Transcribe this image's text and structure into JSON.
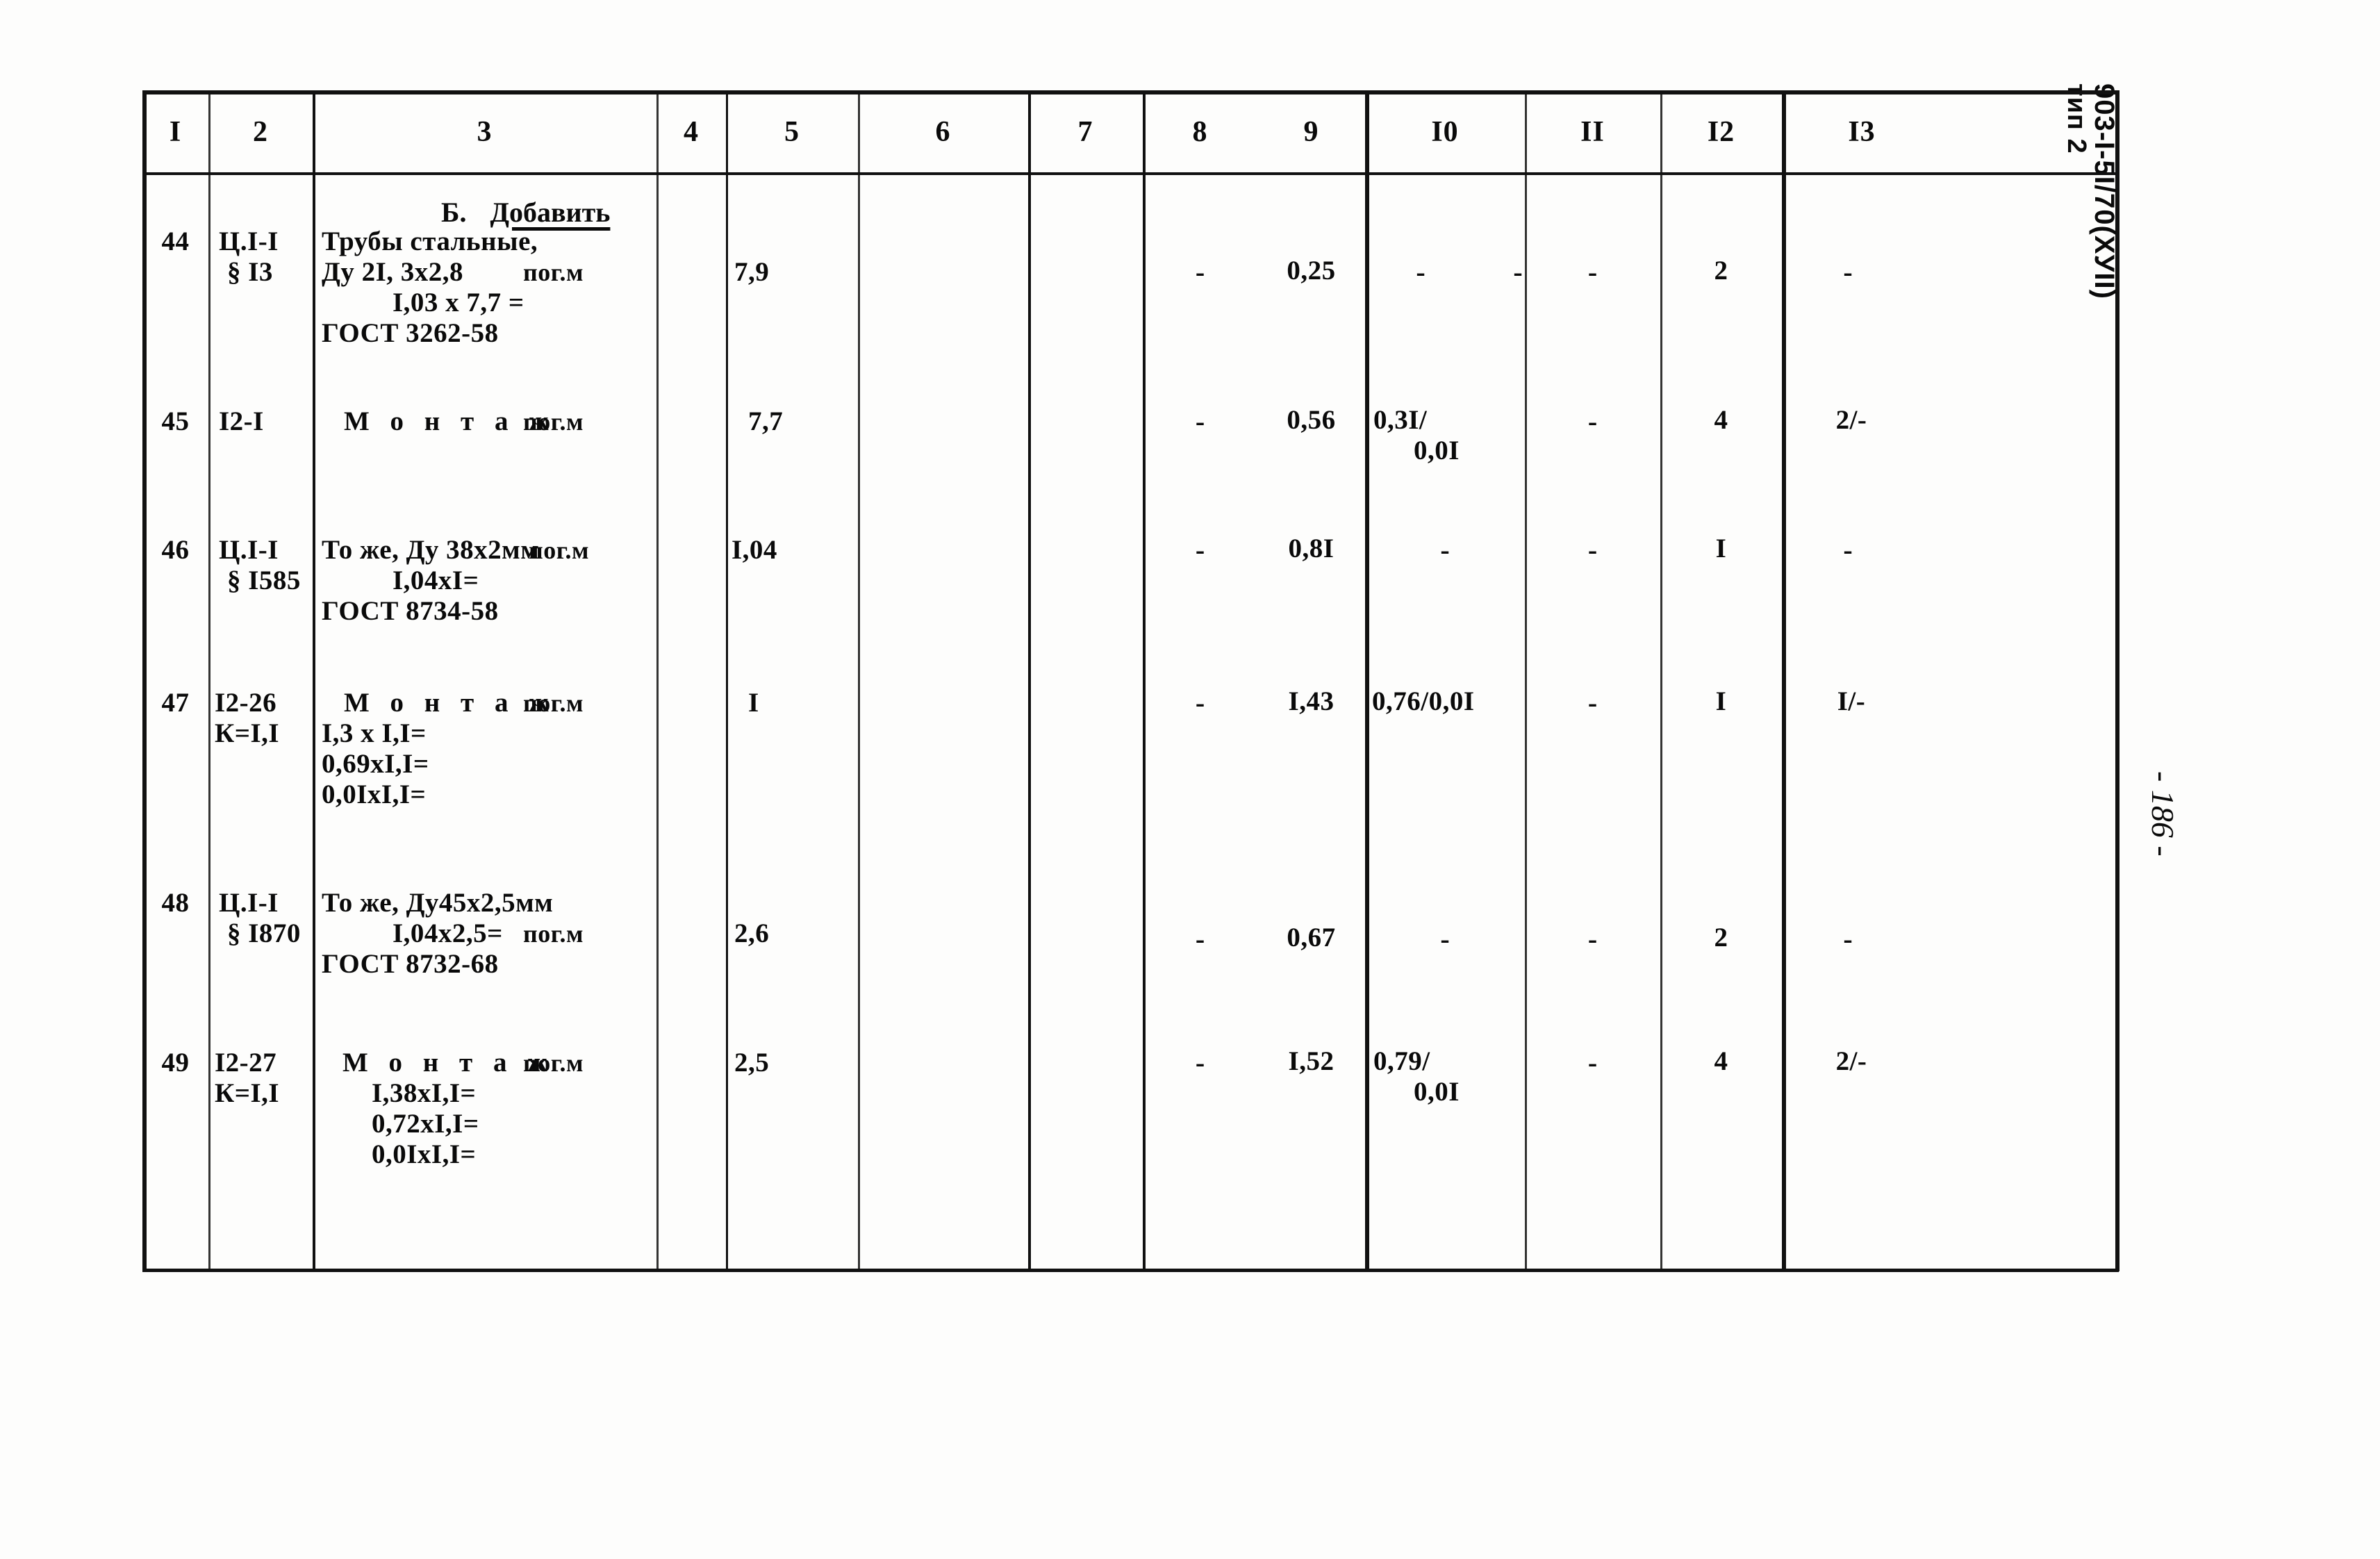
{
  "document": {
    "side_stamp_code": "903-I-5I/70(ХУII)",
    "side_stamp_sub": "тип 2",
    "page_number": "- 186 -"
  },
  "table": {
    "column_headers": [
      "I",
      "2",
      "3",
      "4",
      "5",
      "6",
      "7",
      "8",
      "9",
      "I0",
      "II",
      "I2",
      "I3"
    ],
    "section_caption": {
      "marker": "Б.",
      "text": "Добавить"
    },
    "rows": [
      {
        "num": "44",
        "code_line1": "Ц.I-I",
        "code_line2": "§ I3",
        "desc_line1": "Трубы стальные,",
        "desc_line2": "Ду 2I, 3х2,8",
        "desc_line3": "I,03 х 7,7 =",
        "desc_line4": "ГОСТ 3262-58",
        "unit": "пог.м",
        "qty": "7,9",
        "col6": "",
        "col7": "",
        "col8": "-",
        "col9": "0,25",
        "col10": "-",
        "col10b": "-",
        "col11": "-",
        "col12": "2",
        "col13": "-"
      },
      {
        "num": "45",
        "code_line1": "I2-I",
        "code_line2": "",
        "desc_line1": "М о н т а ж",
        "desc_line2": "",
        "desc_line3": "",
        "desc_line4": "",
        "unit": "пог.м",
        "qty": "7,7",
        "col6": "",
        "col7": "",
        "col8": "-",
        "col9": "0,56",
        "col10": "0,3I/",
        "col10b": "0,0I",
        "col11": "-",
        "col12": "4",
        "col13": "2/-"
      },
      {
        "num": "46",
        "code_line1": "Ц.I-I",
        "code_line2": "§ I585",
        "desc_line1": "То же, Ду 38х2мм",
        "desc_line2": "I,04хI=",
        "desc_line3": "ГОСТ 8734-58",
        "desc_line4": "",
        "unit": "пог.м",
        "qty": "I,04",
        "col6": "",
        "col7": "",
        "col8": "-",
        "col9": "0,8I",
        "col10": "-",
        "col10b": "",
        "col11": "-",
        "col12": "I",
        "col13": "-"
      },
      {
        "num": "47",
        "code_line1": "I2-26",
        "code_line2": "К=I,I",
        "desc_line1": "М о н т а ж",
        "desc_line2": "I,3 х I,I=",
        "desc_line3": "0,69хI,I=",
        "desc_line4": "0,0IхI,I=",
        "unit": "пог.м",
        "qty": "I",
        "col6": "",
        "col7": "",
        "col8": "-",
        "col9": "I,43",
        "col10": "0,76/0,0I",
        "col10b": "",
        "col11": "-",
        "col12": "I",
        "col13": "I/-"
      },
      {
        "num": "48",
        "code_line1": "Ц.I-I",
        "code_line2": "§ I870",
        "desc_line1": "То же, Ду45х2,5мм",
        "desc_line2": "I,04х2,5=",
        "desc_line3": "ГОСТ 8732-68",
        "desc_line4": "",
        "unit": "пог.м",
        "qty": "2,6",
        "col6": "",
        "col7": "",
        "col8": "-",
        "col9": "0,67",
        "col10": "-",
        "col10b": "",
        "col11": "-",
        "col12": "2",
        "col13": "-"
      },
      {
        "num": "49",
        "code_line1": "I2-27",
        "code_line2": "К=I,I",
        "desc_line1": "М о н т а ж",
        "desc_line2": "I,38хI,I=",
        "desc_line3": "0,72хI,I=",
        "desc_line4": "0,0IхI,I=",
        "unit": "пог.м",
        "qty": "2,5",
        "col6": "",
        "col7": "",
        "col8": "-",
        "col9": "I,52",
        "col10": "0,79/",
        "col10b": "0,0I",
        "col11": "-",
        "col12": "4",
        "col13": "2/-"
      }
    ]
  }
}
